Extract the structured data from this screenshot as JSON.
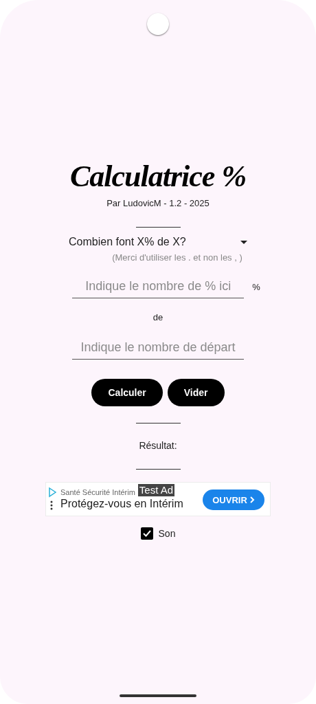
{
  "title": "Calculatrice %",
  "subtitle": "Par LudovicM - 1.2 - 2025",
  "mode_dropdown": {
    "value": "Combien font X% de X?"
  },
  "hint": "(Merci d'utiliser les . et non les , )",
  "percent_field": {
    "placeholder": "Indique le nombre de % ici",
    "unit": "%"
  },
  "connector": "de",
  "start_field": {
    "placeholder": "Indique le nombre de départ"
  },
  "buttons": [
    {
      "label": "Calculer"
    },
    {
      "label": "Vider"
    }
  ],
  "result_label": "Résultat:",
  "ad": {
    "advertiser": "Santé Sécurité Intérim",
    "badge": "Test Ad",
    "headline": "Protégez-vous en Intérim",
    "cta": "OUVRIR"
  },
  "sound": {
    "label": "Son",
    "checked": true
  }
}
